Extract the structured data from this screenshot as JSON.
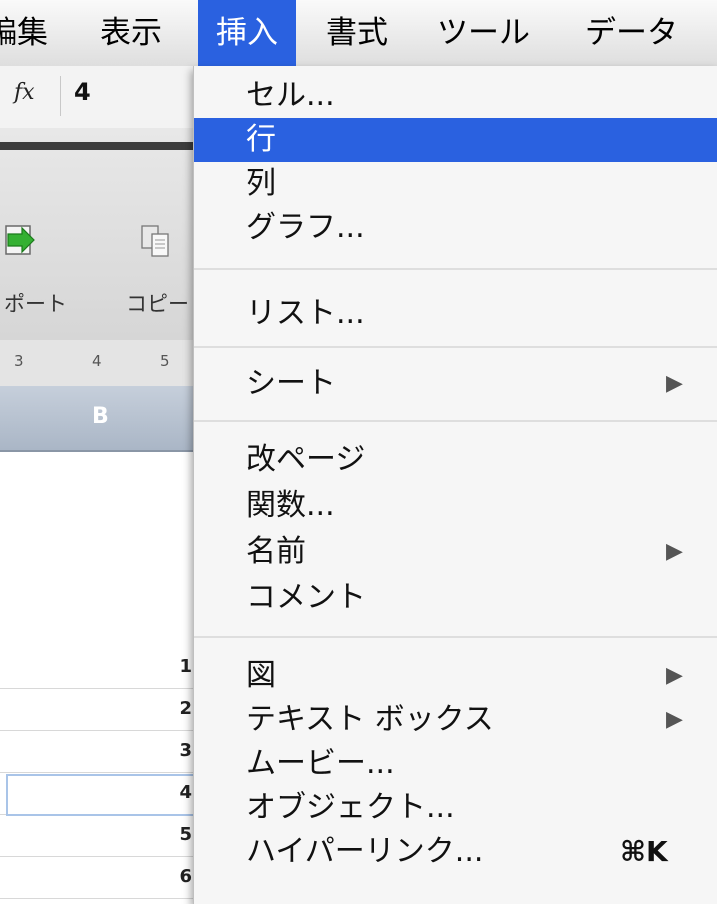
{
  "menubar": {
    "items": [
      {
        "label": "編集",
        "active": false
      },
      {
        "label": "表示",
        "active": false
      },
      {
        "label": "挿入",
        "active": true
      },
      {
        "label": "書式",
        "active": false
      },
      {
        "label": "ツール",
        "active": false
      },
      {
        "label": "データ",
        "active": false
      }
    ]
  },
  "formula": {
    "fx": "fx",
    "value": "4"
  },
  "toolbar": {
    "import_label": "ポート",
    "copy_label": "コピー"
  },
  "ruler": {
    "ticks": [
      "3",
      "4",
      "5"
    ]
  },
  "column_header": "B",
  "rows": [
    "1",
    "2",
    "3",
    "4",
    "5",
    "6"
  ],
  "insert_menu": {
    "title": "挿入",
    "groups": [
      [
        {
          "label": "セル...",
          "submenu": false,
          "shortcut": ""
        },
        {
          "label": "行",
          "submenu": false,
          "shortcut": "",
          "highlighted": true
        },
        {
          "label": "列",
          "submenu": false,
          "shortcut": ""
        },
        {
          "label": "グラフ...",
          "submenu": false,
          "shortcut": ""
        }
      ],
      [
        {
          "label": "リスト...",
          "submenu": false,
          "shortcut": ""
        }
      ],
      [
        {
          "label": "シート",
          "submenu": true,
          "shortcut": ""
        }
      ],
      [
        {
          "label": "改ページ",
          "submenu": false,
          "shortcut": ""
        },
        {
          "label": "関数...",
          "submenu": false,
          "shortcut": ""
        },
        {
          "label": "名前",
          "submenu": true,
          "shortcut": ""
        },
        {
          "label": "コメント",
          "submenu": false,
          "shortcut": ""
        }
      ],
      [
        {
          "label": "図",
          "submenu": true,
          "shortcut": ""
        },
        {
          "label": "テキスト ボックス",
          "submenu": true,
          "shortcut": ""
        },
        {
          "label": "ムービー...",
          "submenu": false,
          "shortcut": ""
        },
        {
          "label": "オブジェクト...",
          "submenu": false,
          "shortcut": ""
        },
        {
          "label": "ハイパーリンク...",
          "submenu": false,
          "shortcut": "⌘K"
        }
      ]
    ]
  },
  "colors": {
    "highlight": "#2a61e0",
    "menu_bg": "#f6f6f6"
  }
}
